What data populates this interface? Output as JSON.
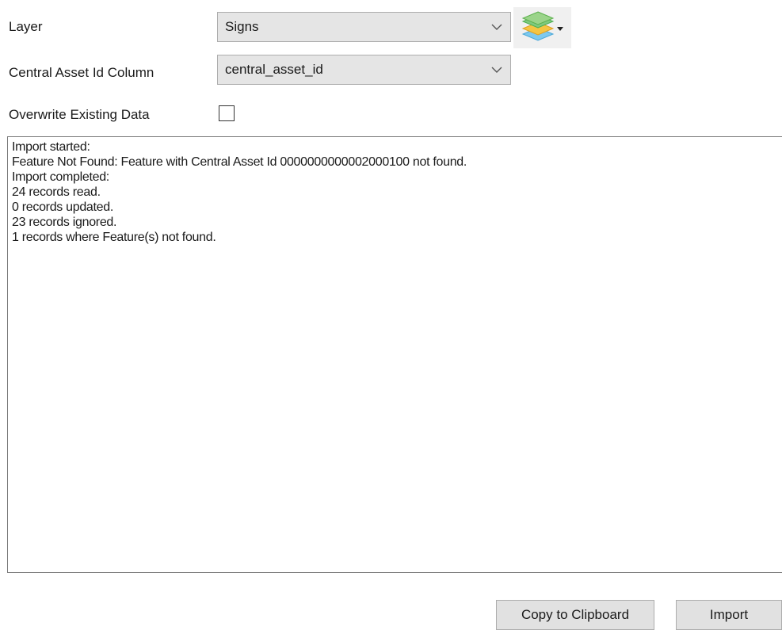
{
  "form": {
    "layer_label": "Layer",
    "layer_value": "Signs",
    "layer_icon": "layers-icon",
    "central_asset_label": "Central Asset Id Column",
    "central_asset_value": "central_asset_id",
    "overwrite_label": "Overwrite Existing Data",
    "overwrite_checked": false
  },
  "log": {
    "lines": [
      "Import started:",
      "Feature Not Found: Feature with Central Asset Id 0000000000002000100 not found.",
      "Import completed:",
      "24 records read.",
      "0 records updated.",
      "23 records ignored.",
      "1 records where Feature(s) not found."
    ]
  },
  "buttons": {
    "copy_label": "Copy to Clipboard",
    "import_label": "Import"
  },
  "colors": {
    "combo_bg": "#e5e5e5",
    "button_bg": "#e1e1e1",
    "border": "#adadad"
  }
}
